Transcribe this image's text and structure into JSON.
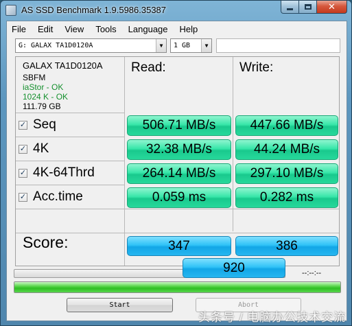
{
  "window": {
    "title": "AS SSD Benchmark 1.9.5986.35387"
  },
  "menu": [
    "File",
    "Edit",
    "View",
    "Tools",
    "Language",
    "Help"
  ],
  "drive_select": {
    "value": "G: GALAX TA1D0120A"
  },
  "size_select": {
    "value": "1 GB"
  },
  "info": {
    "name": "GALAX TA1D0120A",
    "firmware": "SBFM",
    "driver": "iaStor - OK",
    "alignment": "1024 K - OK",
    "capacity": "111.79 GB"
  },
  "headers": {
    "read": "Read:",
    "write": "Write:"
  },
  "rows": [
    {
      "name": "Seq",
      "checked": true,
      "read": "506.71 MB/s",
      "write": "447.66 MB/s"
    },
    {
      "name": "4K",
      "checked": true,
      "read": "32.38 MB/s",
      "write": "44.24 MB/s"
    },
    {
      "name": "4K-64Thrd",
      "checked": true,
      "read": "264.14 MB/s",
      "write": "297.10 MB/s"
    },
    {
      "name": "Acc.time",
      "checked": true,
      "read": "0.059 ms",
      "write": "0.282 ms"
    }
  ],
  "score": {
    "label": "Score:",
    "read": "347",
    "write": "386",
    "total": "920"
  },
  "progress": {
    "time": "--:--:--",
    "test_progress": 0,
    "total_progress": 1.0
  },
  "buttons": {
    "start": "Start",
    "abort": "Abort"
  },
  "watermark": "头条号 / 电脑办公技术交流",
  "colors": {
    "result_green": "#27d89b",
    "score_blue": "#26b6f0",
    "progress_green": "#2fbf24"
  }
}
